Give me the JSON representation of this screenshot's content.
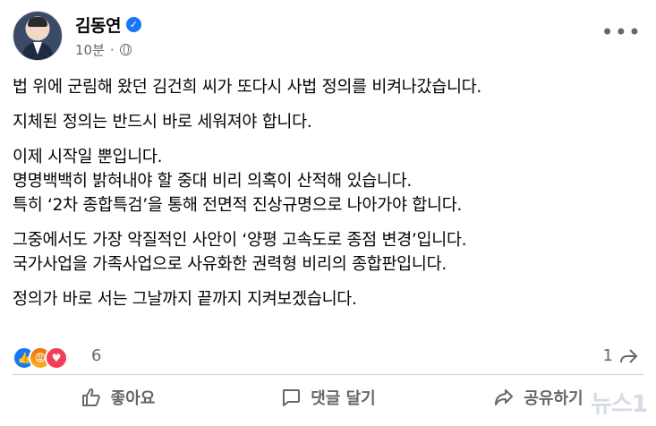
{
  "author": {
    "name": "김동연",
    "time": "10분",
    "separator": "·"
  },
  "post": {
    "paragraphs": [
      [
        "법 위에 군림해 왔던 김건희 씨가 또다시 사법 정의를 비켜나갔습니다."
      ],
      [
        "지체된 정의는 반드시 바로 세워져야 합니다."
      ],
      [
        "이제 시작일 뿐입니다.",
        "명명백백히 밝혀내야 할 중대 비리 의혹이 산적해 있습니다.",
        "특히 ‘2차 종합특검’을 통해 전면적 진상규명으로 나아가야 합니다."
      ],
      [
        "그중에서도 가장 악질적인 사안이 ‘양평 고속도로 종점 변경’입니다.",
        "국가사업을 가족사업으로 사유화한 권력형 비리의 종합판입니다."
      ],
      [
        "정의가 바로 서는 그날까지 끝까지 지켜보겠습니다."
      ]
    ]
  },
  "reactions": {
    "count": "6",
    "shares": "1",
    "icons": [
      "like-icon",
      "angry-icon",
      "love-icon"
    ]
  },
  "actions": {
    "like": "좋아요",
    "comment": "댓글 달기",
    "share": "공유하기"
  },
  "watermark": "뉴스1",
  "colors": {
    "verified": "#1877f2",
    "secondary_text": "#65676b",
    "like": "#1877f2",
    "love": "#f33e58"
  }
}
